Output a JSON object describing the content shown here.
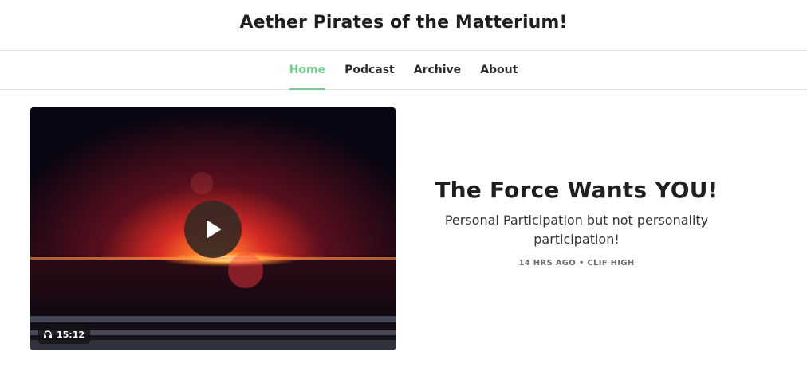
{
  "site": {
    "title": "Aether Pirates of the Matterium!"
  },
  "nav": {
    "items": [
      {
        "label": "Home",
        "active": true
      },
      {
        "label": "Podcast",
        "active": false
      },
      {
        "label": "Archive",
        "active": false
      },
      {
        "label": "About",
        "active": false
      }
    ]
  },
  "post": {
    "title": "The Force Wants YOU!",
    "subtitle": "Personal Participation but not personality participation!",
    "age": "14 HRS AGO",
    "separator": "•",
    "author": "CLIF HIGH",
    "duration": "15:12",
    "duration_icon": "headphones-icon",
    "play_icon": "play-icon"
  },
  "colors": {
    "accent": "#6fd08c",
    "text": "#1f1f1f",
    "meta": "#6e6e6e"
  }
}
